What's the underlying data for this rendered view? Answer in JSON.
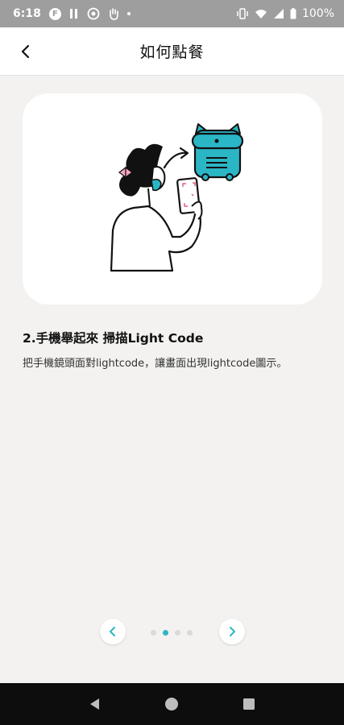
{
  "status_bar": {
    "time": "6:18",
    "battery_percent": "100%",
    "icons": [
      "f-badge-icon",
      "pause-icon",
      "record-icon",
      "hand-icon",
      "dot-icon",
      "vibrate-icon",
      "wifi-icon",
      "signal-icon",
      "battery-icon"
    ]
  },
  "header": {
    "title": "如何點餐",
    "back_icon": "chevron-left-icon"
  },
  "step": {
    "title": "2.手機舉起來 掃描Light Code",
    "description": "把手機鏡頭面對lightcode，讓畫面出現lightcode圖示。"
  },
  "illustration": {
    "icon": "person-scanning-device-illustration",
    "accent_color": "#2bb6c6",
    "bow_color": "#f7a6c0"
  },
  "pager": {
    "total_pages": 4,
    "current_page": 2,
    "prev_icon": "chevron-left-icon",
    "next_icon": "chevron-right-icon",
    "accent_color": "#2bb6c6"
  },
  "system_nav": {
    "back_icon": "triangle-back-icon",
    "home_icon": "circle-home-icon",
    "recents_icon": "square-recents-icon"
  }
}
